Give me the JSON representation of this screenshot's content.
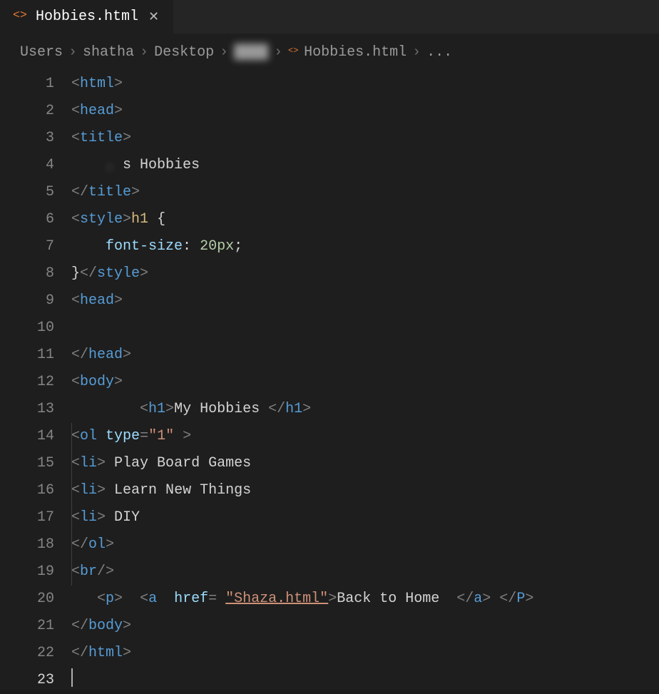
{
  "tab": {
    "filename": "Hobbies.html",
    "close_tooltip": "Close"
  },
  "breadcrumbs": {
    "segments": [
      "Users",
      "shatha",
      "Desktop",
      "",
      "Hobbies.html",
      "..."
    ],
    "blurred_index": 3
  },
  "editor": {
    "line_count": 23,
    "active_line": 23,
    "cursor_line": 23
  },
  "code": {
    "l1": {
      "indent": 0,
      "open": {
        "tag": "html"
      }
    },
    "l2": {
      "indent": 0,
      "open": {
        "tag": "head"
      }
    },
    "l3": {
      "indent": 0,
      "open": {
        "tag": "title"
      }
    },
    "l4": {
      "indent": 0,
      "blurred_prefix": "    . ",
      "text": "s Hobbies"
    },
    "l5": {
      "indent": 0,
      "close": {
        "tag": "title"
      }
    },
    "l6": {
      "indent": 0,
      "open": {
        "tag": "style"
      },
      "selector": "h1",
      "brace": " {"
    },
    "l7": {
      "indent": 1,
      "prop": "font-size",
      "colon": ": ",
      "value": "20px",
      "semi": ";"
    },
    "l8": {
      "indent": 0,
      "text_before": "}",
      "close": {
        "tag": "style"
      }
    },
    "l9": {
      "indent": 0,
      "open": {
        "tag": "head"
      }
    },
    "l10": {
      "indent": 0,
      "blank": true
    },
    "l11": {
      "indent": 0,
      "close": {
        "tag": "head"
      }
    },
    "l12": {
      "indent": 0,
      "open": {
        "tag": "body"
      }
    },
    "l13": {
      "indent": 2,
      "open": {
        "tag": "h1"
      },
      "text": "My Hobbies ",
      "close": {
        "tag": "h1"
      }
    },
    "l14": {
      "indent": 0,
      "open": {
        "tag": "ol",
        "attrs": [
          {
            "name": "type",
            "value": "\"1\""
          }
        ]
      },
      "trail": " >"
    },
    "l15": {
      "indent": 0,
      "open": {
        "tag": "li"
      },
      "text": " Play Board Games"
    },
    "l16": {
      "indent": 0,
      "open": {
        "tag": "li"
      },
      "text": " Learn New Things"
    },
    "l17": {
      "indent": 0,
      "open": {
        "tag": "li"
      },
      "text": " DIY"
    },
    "l18": {
      "indent": 0,
      "close": {
        "tag": "ol"
      }
    },
    "l19": {
      "indent": 0,
      "selfclose": {
        "tag": "br"
      }
    },
    "l20": {
      "indent": 1,
      "p_open": "p",
      "a_open": "a",
      "href_attr": "href",
      "equals": "= ",
      "href_val": "\"Shaza.html\"",
      "link_text": "Back to Home  ",
      "a_close": "a",
      "p_close": "P"
    },
    "l21": {
      "indent": 0,
      "close": {
        "tag": "body"
      }
    },
    "l22": {
      "indent": 0,
      "close": {
        "tag": "html"
      }
    },
    "l23": {
      "indent": 0,
      "cursor": true
    }
  }
}
